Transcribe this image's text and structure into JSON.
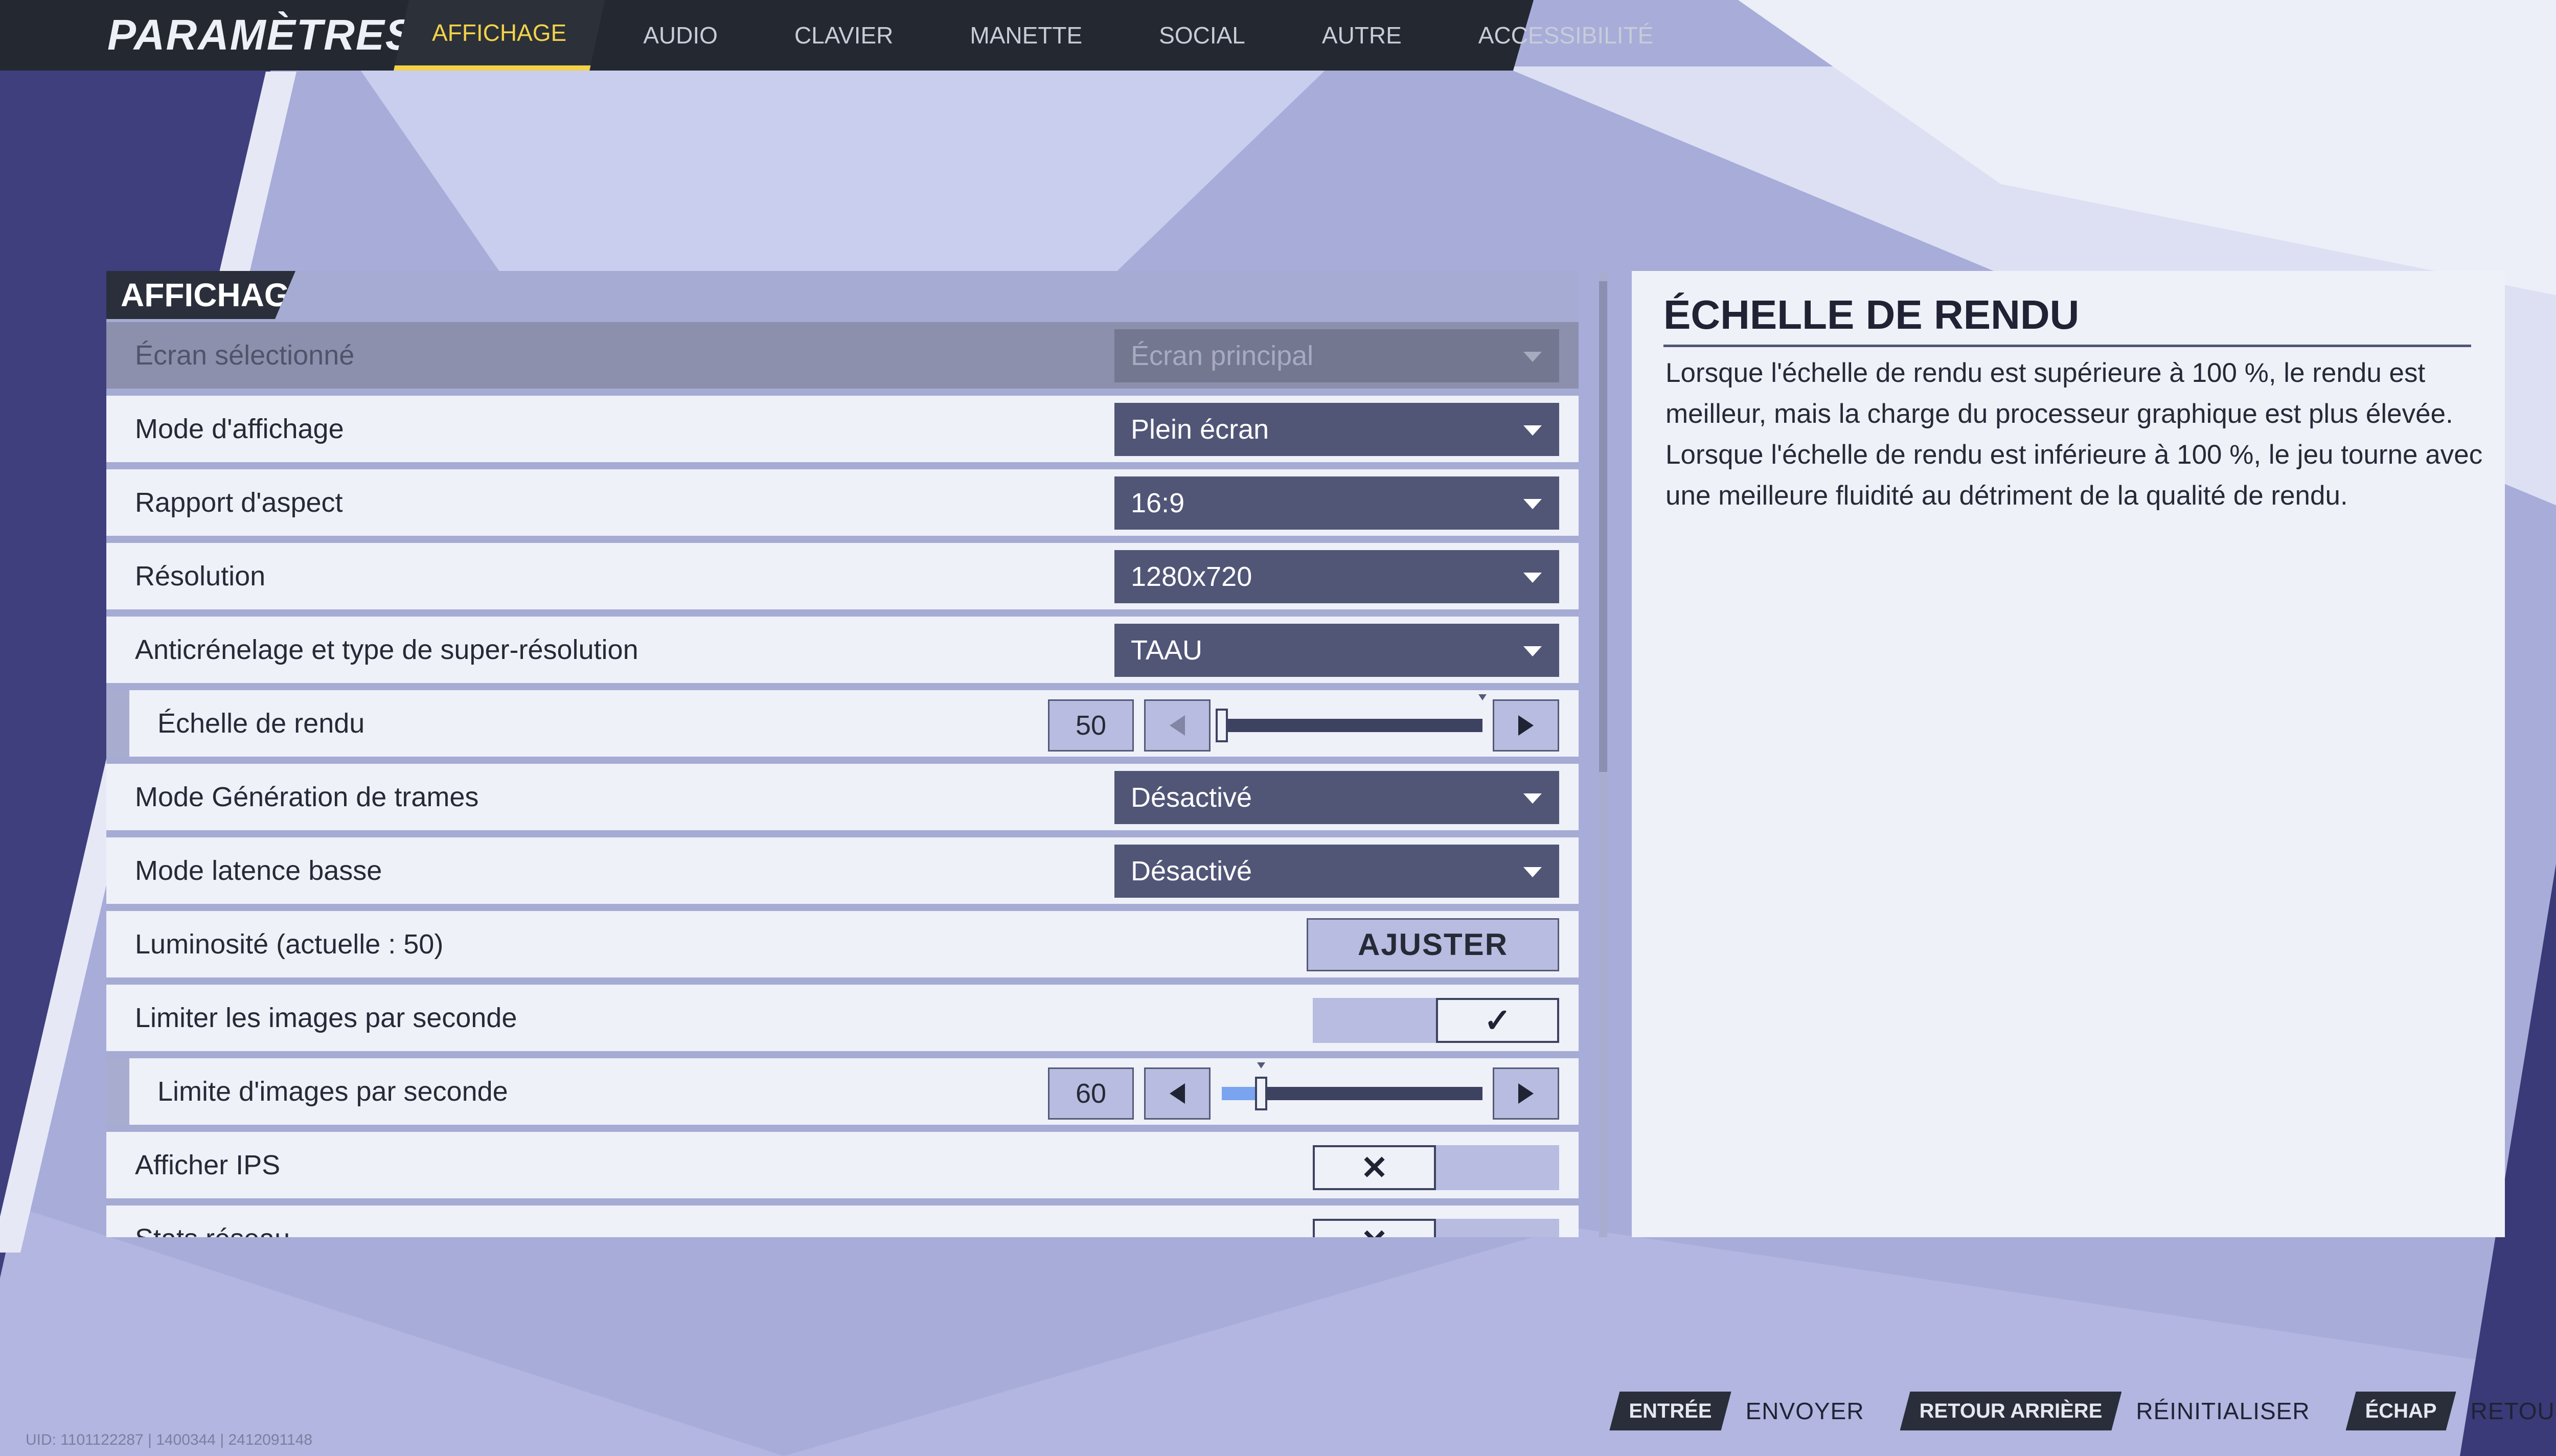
{
  "app_title": "PARAMÈTRES",
  "tabs": [
    {
      "label": "AFFICHAGE",
      "active": true
    },
    {
      "label": "AUDIO"
    },
    {
      "label": "CLAVIER"
    },
    {
      "label": "MANETTE"
    },
    {
      "label": "SOCIAL"
    },
    {
      "label": "AUTRE"
    },
    {
      "label": "ACCESSIBILITÉ"
    }
  ],
  "section_title": "AFFICHAGE",
  "settings": {
    "ecran_selectionne": {
      "label": "Écran sélectionné",
      "value": "Écran principal"
    },
    "mode_affichage": {
      "label": "Mode d'affichage",
      "value": "Plein écran"
    },
    "rapport_aspect": {
      "label": "Rapport d'aspect",
      "value": "16:9"
    },
    "resolution": {
      "label": "Résolution",
      "value": "1280x720"
    },
    "anticrenelage": {
      "label": "Anticrénelage et type de super-résolution",
      "value": "TAAU"
    },
    "echelle_rendu": {
      "label": "Échelle de rendu",
      "value": "50",
      "fraction": 0.0
    },
    "generation_trames": {
      "label": "Mode Génération de trames",
      "value": "Désactivé"
    },
    "latence_basse": {
      "label": "Mode latence basse",
      "value": "Désactivé"
    },
    "luminosite": {
      "label": "Luminosité (actuelle : 50)",
      "button": "AJUSTER"
    },
    "limiter_images": {
      "label": "Limiter les images par seconde",
      "enabled": true
    },
    "limite_images": {
      "label": "Limite d'images par seconde",
      "value": "60",
      "fraction": 0.15
    },
    "afficher_ips": {
      "label": "Afficher IPS",
      "enabled": false
    },
    "stats_reseau": {
      "label": "Stats réseau",
      "enabled": false
    }
  },
  "description": {
    "title": "ÉCHELLE DE RENDU",
    "text": "Lorsque l'échelle de rendu est supérieure à 100 %, le rendu est meilleur, mais la charge du processeur graphique est plus élevée. Lorsque l'échelle de rendu est inférieure à 100 %, le jeu tourne avec une meilleure fluidité au détriment de la qualité de rendu."
  },
  "hints": [
    {
      "key": "ENTRÉE",
      "label": "ENVOYER"
    },
    {
      "key": "RETOUR ARRIÈRE",
      "label": "RÉINITIALISER"
    },
    {
      "key": "ÉCHAP",
      "label": "RETOUR"
    }
  ],
  "uid": "UID: 1101122287 | 1400344 | 2412091148",
  "icons": {
    "dropdown": "caret-down-icon",
    "check": "checkmark-icon",
    "cross": "cross-icon"
  }
}
